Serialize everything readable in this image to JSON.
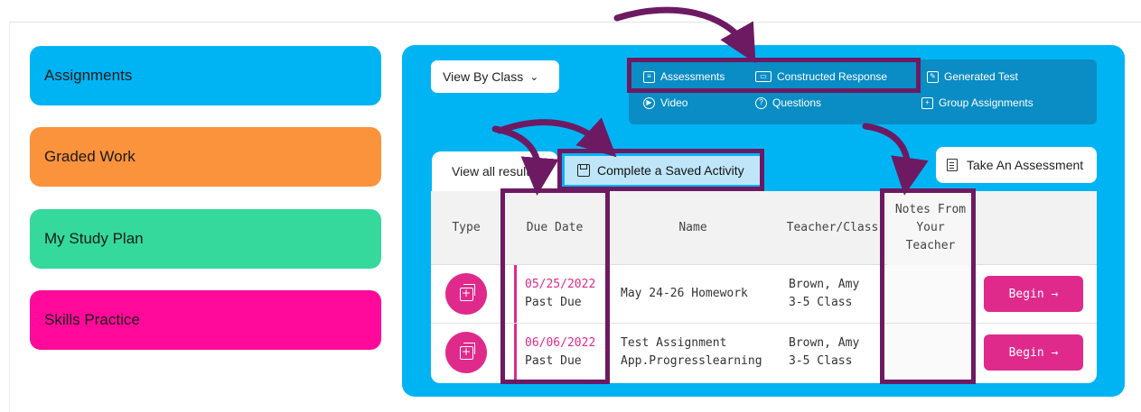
{
  "sidebar": {
    "items": [
      {
        "label": "Assignments",
        "color": "#00b4f4"
      },
      {
        "label": "Graded Work",
        "color": "#fb923c"
      },
      {
        "label": "My Study Plan",
        "color": "#34d99b"
      },
      {
        "label": "Skills Practice",
        "color": "#ff0a9a"
      }
    ]
  },
  "toolbar": {
    "view_by": "View By Class",
    "view_by_icon": "chevron-down-icon",
    "tools": {
      "assessments": "Assessments",
      "constructed_response": "Constructed Response",
      "generated_test": "Generated Test",
      "video": "Video",
      "questions": "Questions",
      "group_assignments": "Group Assignments"
    }
  },
  "tabs": {
    "view_all": "View all results",
    "saved_activity": "Complete a Saved Activity",
    "take_assessment": "Take An Assessment"
  },
  "table": {
    "headers": {
      "type": "Type",
      "due": "Due Date",
      "name": "Name",
      "teacher": "Teacher/Class",
      "notes_1": "Notes From",
      "notes_2": "Your",
      "notes_3": "Teacher"
    },
    "rows": [
      {
        "due_date": "05/25/2022",
        "status": "Past Due",
        "name_1": "May 24-26 Homework",
        "name_2": "",
        "teacher": "Brown, Amy",
        "class": "3-5 Class",
        "action": "Begin →"
      },
      {
        "due_date": "06/06/2022",
        "status": "Past Due",
        "name_1": "Test Assignment",
        "name_2": "App.Progresslearning",
        "teacher": "Brown, Amy",
        "class": "3-5 Class",
        "action": "Begin →"
      }
    ]
  },
  "colors": {
    "panel": "#00b4f4",
    "accent_pink": "#df2a8c",
    "annotation": "#6d1a62"
  }
}
